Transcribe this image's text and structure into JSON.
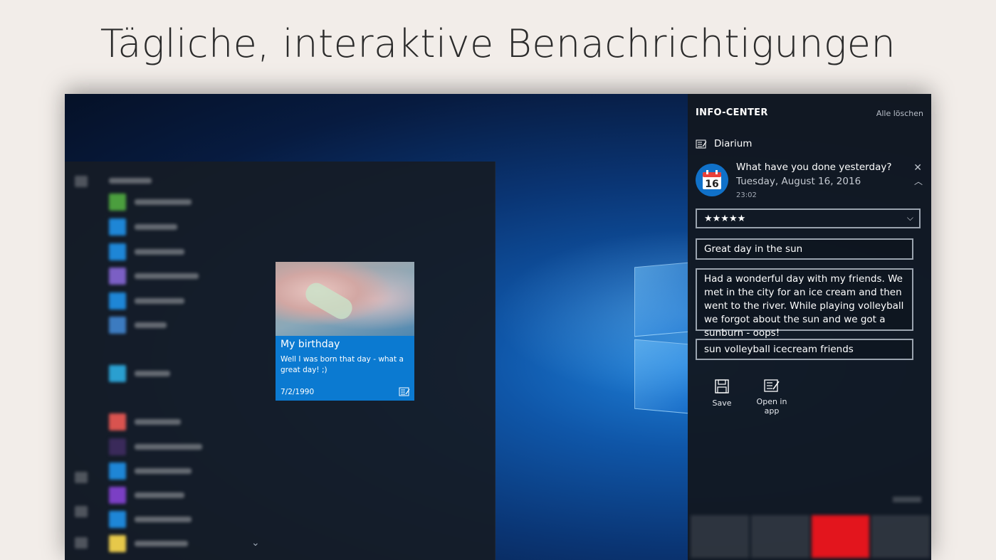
{
  "headline": "Tägliche, interaktive Benachrichtigungen",
  "tile": {
    "title": "My birthday",
    "body": "Well I was born that day - what a great day! ;)",
    "date": "7/2/1990",
    "icon": "journal-icon"
  },
  "action_center": {
    "title": "INFO-CENTER",
    "clear_all": "Alle löschen",
    "app_name": "Diarium",
    "app_icon": "journal-icon",
    "notification": {
      "calendar_day": "16",
      "title": "What have you done yesterday?",
      "subtitle": "Tuesday, August 16, 2016",
      "time": "23:02",
      "rating": "★★★★★",
      "entry_title": "Great day in the sun",
      "entry_text": "Had a wonderful day with my friends. We met in the city for an ice cream and then went to the river. While playing volleyball we forgot about the sun and we got a sunburn - oops!",
      "tags": "sun volleyball icecream friends",
      "save_label": "Save",
      "open_label": "Open in app"
    }
  },
  "colors": {
    "tile_blue": "#0b7ad1",
    "calendar_blue": "#1071c9",
    "panel_bg": "#121821",
    "quick_action_red": "#e3151d"
  }
}
